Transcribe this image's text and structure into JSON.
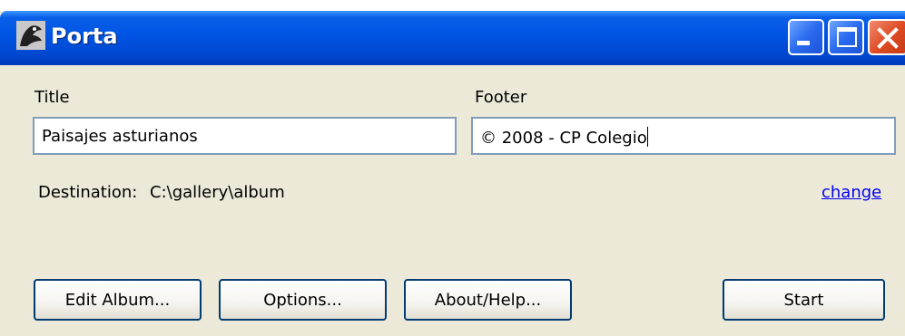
{
  "window": {
    "title": "Porta",
    "icon": "app-icon",
    "controls": [
      "minimize",
      "maximize",
      "close"
    ]
  },
  "form": {
    "title_label": "Title",
    "title_value": "Paisajes asturianos",
    "footer_label": "Footer",
    "footer_value": "© 2008 - CP Colegio",
    "destination_label": "Destination:",
    "destination_value": "C:\\gallery\\album",
    "change_link": "change"
  },
  "buttons": {
    "edit_album": "Edit Album...",
    "options": "Options...",
    "about_help": "About/Help...",
    "start": "Start"
  }
}
